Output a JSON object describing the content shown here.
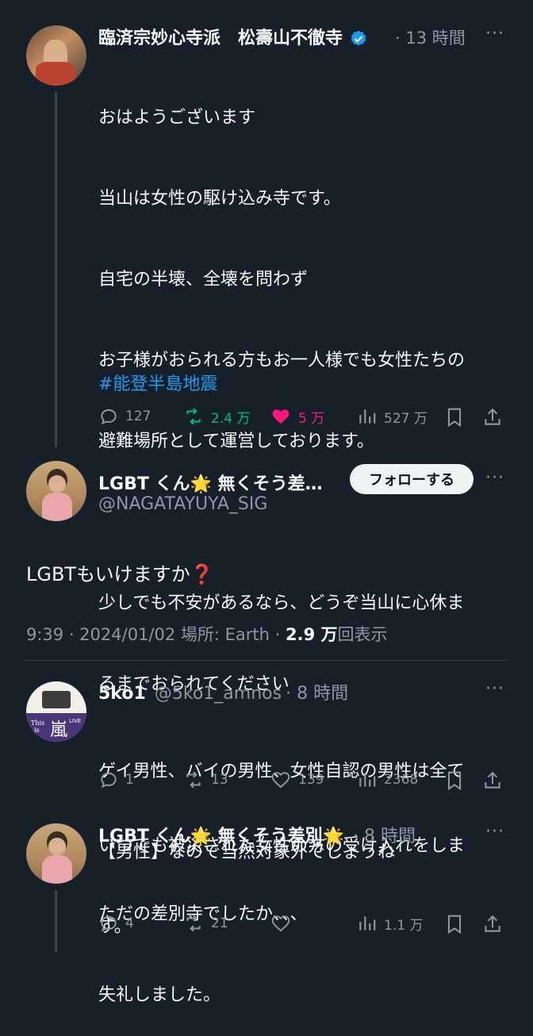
{
  "tweet1": {
    "name": "臨済宗妙心寺派　松壽山不徹寺",
    "time": "13 時間",
    "lines": [
      "おはようございます",
      "当山は女性の駆け込み寺です。",
      "自宅の半壊、全壊を問わず",
      "お子様がおられる方もお一人様でも女性たちの",
      "避難場所として運営しております。",
      "",
      "少しでも不安があるなら、どうぞ当山に心休ま",
      "るまでおられてください",
      "",
      "いつでも被災された女性の方の受け入れをしま",
      "す。"
    ],
    "hashtag": "#能登半島地震",
    "replies": "127",
    "retweets": "2.4 万",
    "likes": "5 万",
    "views": "527 万",
    "colors": {
      "retweet": "#00ba7c",
      "like": "#f91880",
      "hashtag": "#1d9bf0"
    }
  },
  "main_tweet": {
    "name": "LGBT くん🌟 無くそう差…",
    "handle": "@NAGATAYUYA_SIG",
    "follow_label": "フォローする",
    "text": "LGBTもいけますか",
    "emoji": "❓",
    "time": "9:39 · 2024/01/02 場所: Earth · ",
    "views_count": "2.9 万",
    "views_label": "回表示"
  },
  "reply1": {
    "name": "5ko1",
    "handle": "@5ko1_amnos",
    "time": "· 8 時間",
    "lines": [
      "ゲイ男性、バイの男性、女性自認の男性は全て",
      "【男性】なので当然対象外でしょうね"
    ],
    "replies": "1",
    "retweets": "13",
    "likes": "139",
    "views": "2368",
    "avatar_text": {
      "line1": "This",
      "line2": "is",
      "kanji": "嵐",
      "tag": "LIVE"
    }
  },
  "reply2": {
    "name": "LGBT くん🌟 無くそう差別🌟",
    "time": "· 8 時間",
    "lines": [
      "ただの差別寺でしたか、、、",
      "失礼しました。"
    ],
    "replies": "4",
    "retweets": "21",
    "views": "1.1 万"
  }
}
